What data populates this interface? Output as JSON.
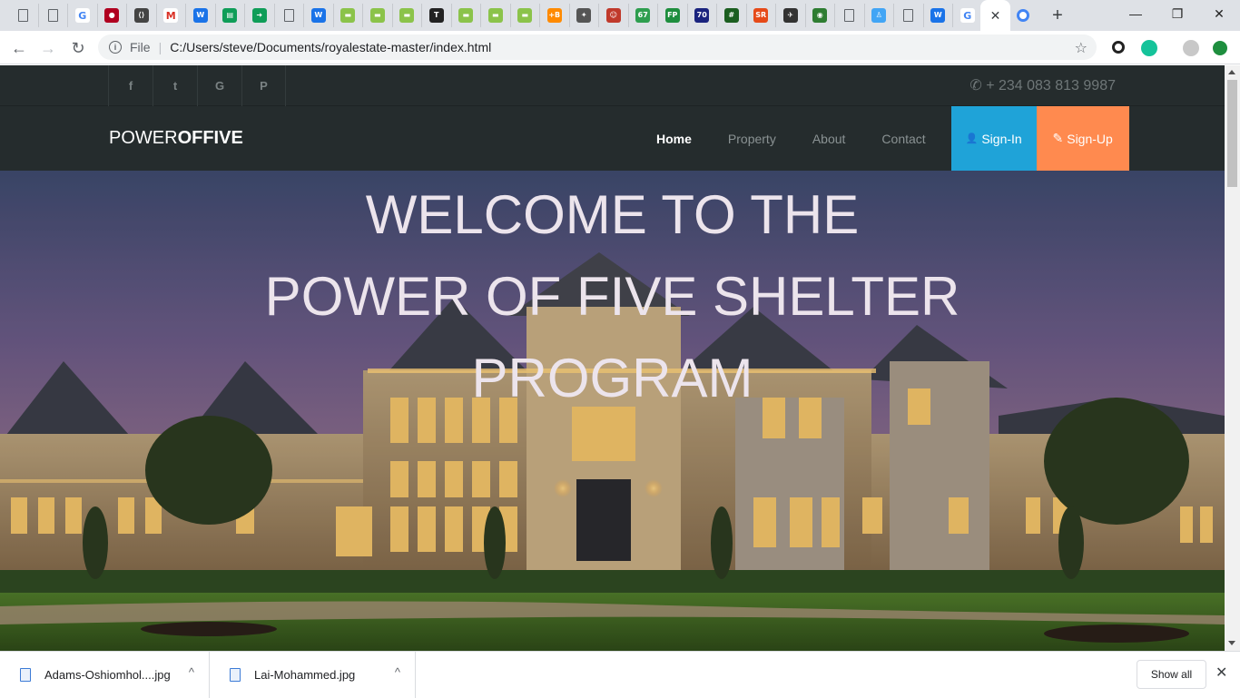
{
  "browser": {
    "tab_favicons": [
      {
        "icon": "doc-icon",
        "color": "#5f6368",
        "glyph": ""
      },
      {
        "icon": "doc-icon",
        "color": "#5f6368",
        "glyph": ""
      },
      {
        "icon": "google-icon",
        "color": "#ffffff",
        "glyph": "G"
      },
      {
        "icon": "record-icon",
        "color": "#b00020",
        "glyph": "●"
      },
      {
        "icon": "code-icon",
        "color": "#444444",
        "glyph": "⟨⟩"
      },
      {
        "icon": "gmail-icon",
        "color": "#ffffff",
        "glyph": "M"
      },
      {
        "icon": "w-icon",
        "color": "#1a73e8",
        "glyph": "W"
      },
      {
        "icon": "sheets-icon",
        "color": "#0f9d58",
        "glyph": "▤"
      },
      {
        "icon": "share-icon",
        "color": "#0f9d58",
        "glyph": "➜"
      },
      {
        "icon": "doc-icon",
        "color": "#5f6368",
        "glyph": ""
      },
      {
        "icon": "w-icon",
        "color": "#1a73e8",
        "glyph": "W"
      },
      {
        "icon": "book-icon",
        "color": "#8bc34a",
        "glyph": "▬"
      },
      {
        "icon": "book-icon",
        "color": "#8bc34a",
        "glyph": "▬"
      },
      {
        "icon": "book-icon",
        "color": "#8bc34a",
        "glyph": "▬"
      },
      {
        "icon": "t-icon",
        "color": "#222222",
        "glyph": "T"
      },
      {
        "icon": "book-icon",
        "color": "#8bc34a",
        "glyph": "▬"
      },
      {
        "icon": "book-icon",
        "color": "#8bc34a",
        "glyph": "▬"
      },
      {
        "icon": "book-icon",
        "color": "#8bc34a",
        "glyph": "▬"
      },
      {
        "icon": "plus-b-icon",
        "color": "#ff8a00",
        "glyph": "+B"
      },
      {
        "icon": "eagle-icon",
        "color": "#555555",
        "glyph": "✦"
      },
      {
        "icon": "face-icon",
        "color": "#c0392b",
        "glyph": "☺"
      },
      {
        "icon": "number-icon",
        "color": "#2e9e4f",
        "glyph": "67"
      },
      {
        "icon": "fp-icon",
        "color": "#1e8e3e",
        "glyph": "FP"
      },
      {
        "icon": "seventy-icon",
        "color": "#1a237e",
        "glyph": "70"
      },
      {
        "icon": "grid-icon",
        "color": "#1b5e20",
        "glyph": "#"
      },
      {
        "icon": "sr-icon",
        "color": "#e64a19",
        "glyph": "SR"
      },
      {
        "icon": "bird-icon",
        "color": "#333333",
        "glyph": "✈"
      },
      {
        "icon": "swirl-icon",
        "color": "#2e7d32",
        "glyph": "◉"
      },
      {
        "icon": "doc-icon",
        "color": "#5f6368",
        "glyph": ""
      },
      {
        "icon": "person-icon",
        "color": "#42a5f5",
        "glyph": "♙"
      },
      {
        "icon": "doc-icon",
        "color": "#5f6368",
        "glyph": ""
      },
      {
        "icon": "w-icon",
        "color": "#1a73e8",
        "glyph": "W"
      },
      {
        "icon": "google-icon",
        "color": "#ffffff",
        "glyph": "G"
      }
    ],
    "active_tab_close": "✕",
    "new_tab": "+",
    "window_controls": {
      "minimize": "—",
      "maximize": "❐",
      "close": "✕"
    },
    "address": {
      "info_glyph": "i",
      "scheme_label": "File",
      "url": "C:/Users/steve/Documents/royalestate-master/index.html"
    },
    "accent_color": "#1a73e8"
  },
  "site": {
    "socials": [
      {
        "icon": "facebook-icon",
        "glyph": "f"
      },
      {
        "icon": "twitter-icon",
        "glyph": "t"
      },
      {
        "icon": "google-plus-icon",
        "glyph": "G"
      },
      {
        "icon": "pinterest-icon",
        "glyph": "P"
      }
    ],
    "phone": {
      "icon": "phone-icon",
      "glyph": "✆",
      "number": "+ 234 083 813 9987"
    },
    "brand": {
      "light": "POWER",
      "bold": "OFFIVE"
    },
    "nav": [
      {
        "label": "Home",
        "active": true
      },
      {
        "label": "Property",
        "active": false
      },
      {
        "label": "About",
        "active": false
      },
      {
        "label": "Contact",
        "active": false
      }
    ],
    "signin": {
      "icon": "user-icon",
      "glyph": "👤",
      "label": "Sign-In",
      "color": "#1fa3d8"
    },
    "signup": {
      "icon": "pencil-icon",
      "glyph": "✎",
      "label": "Sign-Up",
      "color": "#ff8a4f"
    },
    "hero": {
      "lines": [
        "WELCOME TO THE",
        "POWER OF FIVE SHELTER",
        "PROGRAM"
      ]
    }
  },
  "downloads": {
    "items": [
      {
        "name": "Adams-Oshiomhol....jpg"
      },
      {
        "name": "Lai-Mohammed.jpg"
      }
    ],
    "show_all": "Show all",
    "close_glyph": "✕",
    "chevron_glyph": "^"
  }
}
